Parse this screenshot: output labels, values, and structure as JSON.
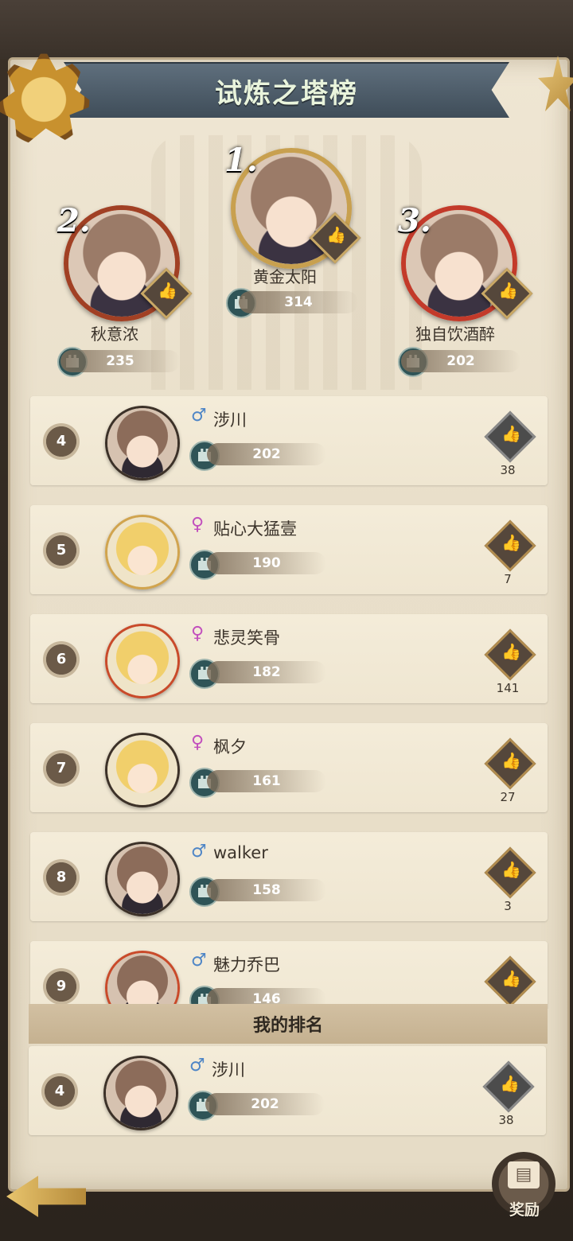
{
  "title": "试炼之塔榜",
  "podium": [
    {
      "rank": "1.",
      "name": "黄金太阳",
      "score": "314"
    },
    {
      "rank": "2.",
      "name": "秋意浓",
      "score": "235"
    },
    {
      "rank": "3.",
      "name": "独自饮酒醉",
      "score": "202"
    }
  ],
  "list": [
    {
      "rank": "4",
      "gender": "♂",
      "name": "涉川",
      "score": "202",
      "likes": "38"
    },
    {
      "rank": "5",
      "gender": "♀",
      "name": "贴心大猛壹",
      "score": "190",
      "likes": "7"
    },
    {
      "rank": "6",
      "gender": "♀",
      "name": "悲灵笑骨",
      "score": "182",
      "likes": "141"
    },
    {
      "rank": "7",
      "gender": "♀",
      "name": "枫夕",
      "score": "161",
      "likes": "27"
    },
    {
      "rank": "8",
      "gender": "♂",
      "name": "walker",
      "score": "158",
      "likes": "3"
    },
    {
      "rank": "9",
      "gender": "♂",
      "name": "魅力乔巴",
      "score": "146",
      "likes": ""
    }
  ],
  "my_rank": {
    "header": "我的排名",
    "rank": "4",
    "gender": "♂",
    "name": "涉川",
    "score": "202",
    "likes": "38"
  },
  "reward_label": "奖励",
  "icons": {
    "like": "thumbs-up-icon",
    "score": "tower-icon",
    "back": "back-arrow-icon",
    "reward": "reward-map-icon"
  },
  "colors": {
    "male": "#4f86c6",
    "female": "#c24fbd",
    "title_text": "#e9f4dc"
  }
}
